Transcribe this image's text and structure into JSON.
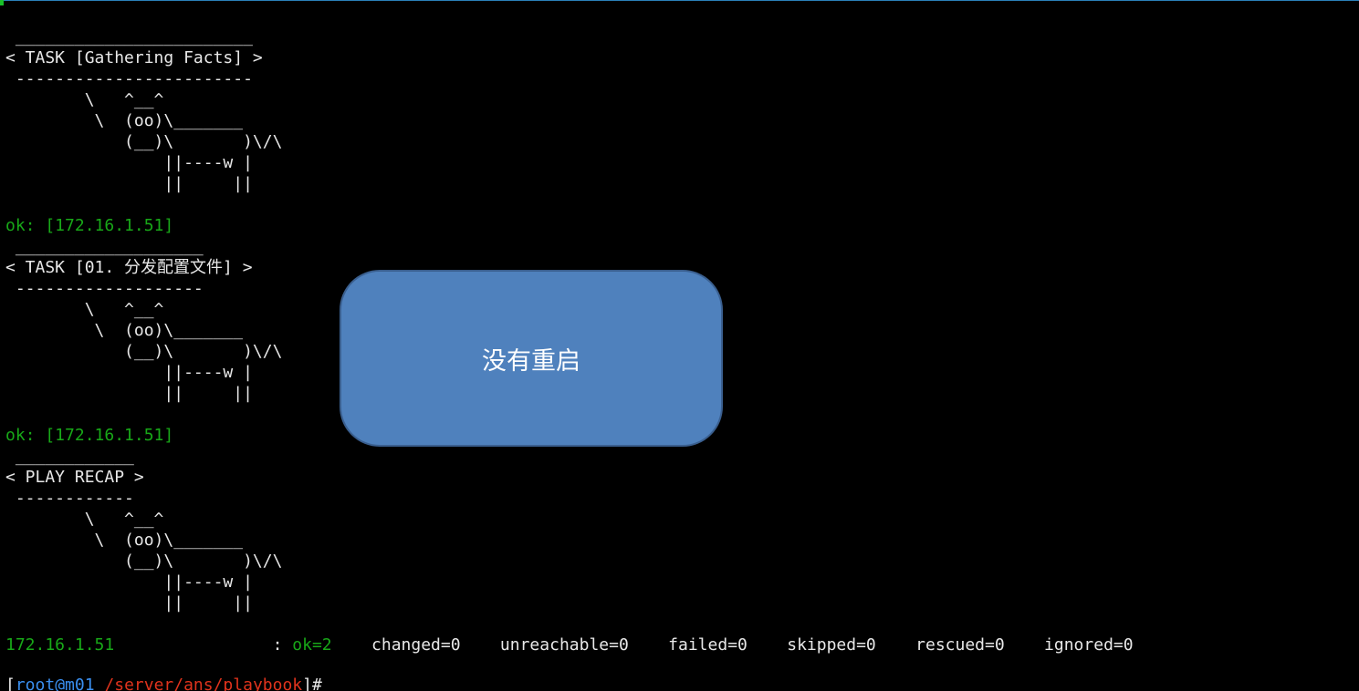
{
  "terminal": {
    "colors": {
      "background": "#000000",
      "text": "#e8e8e8",
      "ok": "#18a818",
      "prompt_user": "#3a8ff0",
      "prompt_path": "#e0331c",
      "overlay_fill": "#4f81bd"
    },
    "task1": {
      "top_rule": " ________________________",
      "header": "< TASK [Gathering Facts] >",
      "bottom_rule": " ------------------------",
      "cow": [
        "        \\   ^__^",
        "         \\  (oo)\\_______",
        "            (__)\\       )\\/\\",
        "                ||----w |",
        "                ||     ||"
      ],
      "result": "ok: [172.16.1.51]"
    },
    "task2": {
      "top_rule": " ___________________",
      "header": "< TASK [01. 分发配置文件] >",
      "bottom_rule": " -------------------",
      "cow": [
        "        \\   ^__^",
        "         \\  (oo)\\_______",
        "            (__)\\       )\\/\\",
        "                ||----w |",
        "                ||     ||"
      ],
      "result": "ok: [172.16.1.51]"
    },
    "recap": {
      "top_rule": " ____________",
      "header": "< PLAY RECAP >",
      "bottom_rule": " ------------",
      "cow": [
        "        \\   ^__^",
        "         \\  (oo)\\_______",
        "            (__)\\       )\\/\\",
        "                ||----w |",
        "                ||     ||"
      ],
      "host": "172.16.1.51",
      "colon": ":",
      "ok": "ok=2",
      "changed": "changed=0",
      "unreachable": "unreachable=0",
      "failed": "failed=0",
      "skipped": "skipped=0",
      "rescued": "rescued=0",
      "ignored": "ignored=0"
    },
    "prompt": {
      "open": "[",
      "user_host": "root@m01",
      "path": "/server/ans/playbook",
      "close": "]#"
    }
  },
  "overlay": {
    "text": "没有重启"
  }
}
